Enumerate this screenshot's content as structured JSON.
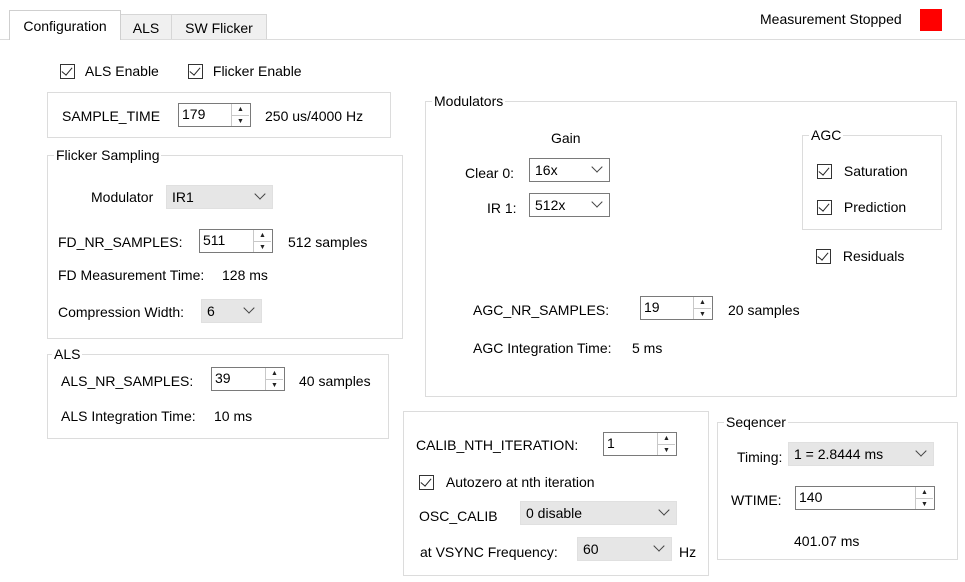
{
  "tabs": [
    {
      "label": "Configuration",
      "active": true
    },
    {
      "label": "ALS",
      "active": false
    },
    {
      "label": "SW Flicker",
      "active": false
    }
  ],
  "status": {
    "text": "Measurement Stopped",
    "color": "#ff0000"
  },
  "enables": {
    "als_enable": {
      "label": "ALS Enable",
      "checked": true
    },
    "flicker_enable": {
      "label": "Flicker Enable",
      "checked": true
    }
  },
  "sample_time": {
    "label": "SAMPLE_TIME",
    "value": "179",
    "info": "250 us/4000 Hz"
  },
  "flicker": {
    "title": "Flicker Sampling",
    "modulator_label": "Modulator",
    "modulator_value": "IR1",
    "fd_nr_label": "FD_NR_SAMPLES:",
    "fd_nr_value": "511",
    "fd_nr_info": "512 samples",
    "fd_time_label": "FD Measurement Time:",
    "fd_time_value": "128 ms",
    "compression_label": "Compression Width:",
    "compression_value": "6"
  },
  "als": {
    "title": "ALS",
    "nr_label": "ALS_NR_SAMPLES:",
    "nr_value": "39",
    "nr_info": "40 samples",
    "time_label": "ALS Integration Time:",
    "time_value": "10 ms"
  },
  "modulators": {
    "title": "Modulators",
    "gain_header": "Gain",
    "clear_label": "Clear 0:",
    "clear_value": "16x",
    "ir_label": "IR 1:",
    "ir_value": "512x",
    "agc": {
      "title": "AGC",
      "saturation": {
        "label": "Saturation",
        "checked": true
      },
      "prediction": {
        "label": "Prediction",
        "checked": true
      }
    },
    "residuals": {
      "label": "Residuals",
      "checked": true
    },
    "agc_nr_label": "AGC_NR_SAMPLES:",
    "agc_nr_value": "19",
    "agc_nr_info": "20 samples",
    "agc_time_label": "AGC Integration Time:",
    "agc_time_value": "5 ms"
  },
  "calib": {
    "nth_label": "CALIB_NTH_ITERATION:",
    "nth_value": "1",
    "autozero": {
      "label": "Autozero at nth iteration",
      "checked": true
    },
    "osc_label": "OSC_CALIB",
    "osc_value": "0 disable",
    "vsync_label": "at VSYNC Frequency:",
    "vsync_value": "60",
    "vsync_unit": "Hz"
  },
  "sequencer": {
    "title": "Seqencer",
    "timing_label": "Timing:",
    "timing_value": "1 = 2.8444 ms",
    "wtime_label": "WTIME:",
    "wtime_value": "140",
    "wtime_info": "401.07 ms"
  }
}
